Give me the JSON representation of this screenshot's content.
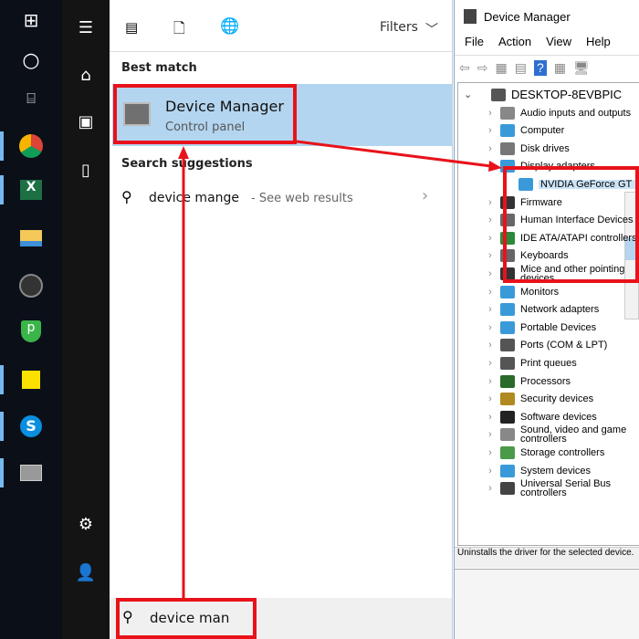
{
  "taskbar": {
    "icons": [
      "windows-start-icon",
      "cortana-icon",
      "task-view-icon",
      "chrome-icon",
      "excel-icon",
      "file-explorer-icon",
      "obs-icon",
      "purevpn-icon",
      "sticky-notes-icon",
      "skype-icon",
      "device-manager-icon"
    ]
  },
  "rail": {
    "icons": [
      "hamburger-icon",
      "home-icon",
      "documents-icon",
      "devices-icon",
      "settings-icon",
      "feedback-icon"
    ]
  },
  "search": {
    "toolbar": {
      "filters_label": "Filters"
    },
    "best_match_heading": "Best match",
    "best_match": {
      "title": "Device Manager",
      "subtitle": "Control panel"
    },
    "suggestions_heading": "Search suggestions",
    "suggestion": {
      "query": "device mange",
      "hint": "- See web results"
    },
    "input_value": "device man"
  },
  "device_manager": {
    "title": "Device Manager",
    "menu": [
      "File",
      "Action",
      "View",
      "Help"
    ],
    "root": "DESKTOP-8EVBPIC",
    "items": [
      "Audio inputs and outputs",
      "Computer",
      "Disk drives",
      "Display adapters",
      "NVIDIA GeForce GT",
      "Firmware",
      "Human Interface Devices",
      "IDE ATA/ATAPI controllers",
      "Keyboards",
      "Mice and other pointing devices",
      "Monitors",
      "Network adapters",
      "Portable Devices",
      "Ports (COM & LPT)",
      "Print queues",
      "Processors",
      "Security devices",
      "Software devices",
      "Sound, video and game controllers",
      "Storage controllers",
      "System devices",
      "Universal Serial Bus controllers"
    ],
    "status": "Uninstalls the driver for the selected device."
  },
  "colors": {
    "highlight": "#b3d5f0",
    "annotation": "#e8121a",
    "taskbar": "#0a0f18"
  }
}
